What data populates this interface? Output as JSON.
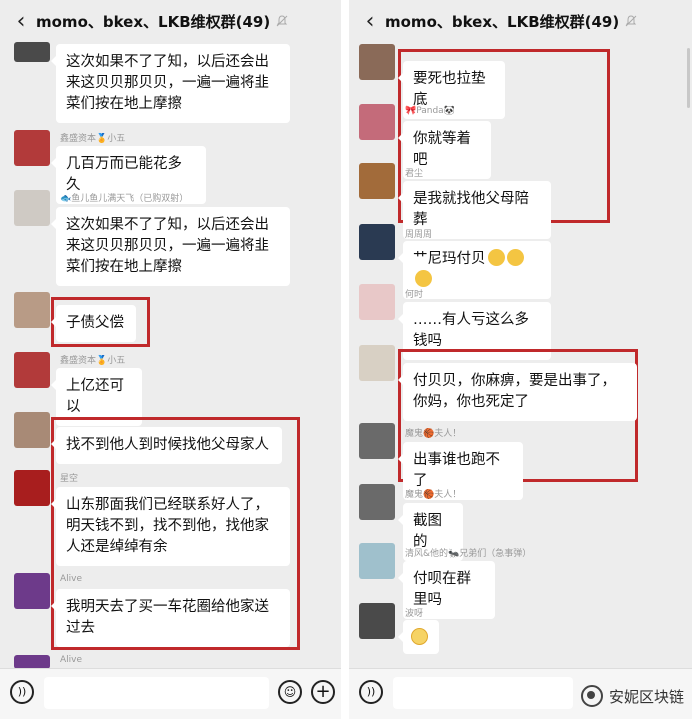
{
  "left": {
    "title": "momo、bkex、LKB维权群(49)",
    "messages": [
      {
        "name": "",
        "text": "这次如果不了了知，以后还会出来这贝贝那贝贝，一遍一遍将韭菜们按在地上摩擦"
      },
      {
        "name": "鑫盛资本🏅小五",
        "text": "几百万而已能花多久"
      },
      {
        "name": "🐟鱼儿鱼儿满天飞（已购双射）",
        "text": "这次如果不了了知，以后还会出来这贝贝那贝贝，一遍一遍将韭菜们按在地上摩擦"
      },
      {
        "name": "",
        "text": "子债父偿"
      },
      {
        "name": "鑫盛资本🏅小五",
        "text": "上亿还可以"
      },
      {
        "name": "",
        "text": "找不到他人到时候找他父母家人"
      },
      {
        "name": "星空",
        "text": "山东那面我们已经联系好人了，明天钱不到，找不到他，找他家人还是绰绰有余"
      },
      {
        "name": "Alive",
        "text": "我明天去了买一车花圈给他家送过去"
      },
      {
        "name": "Alive",
        "text": ""
      }
    ]
  },
  "right": {
    "title": "momo、bkex、LKB维权群(49)",
    "messages": [
      {
        "name": "",
        "text": "要死也拉垫底"
      },
      {
        "name": "🎀Panda🐼",
        "text": "你就等着吧"
      },
      {
        "name": "君尘",
        "text": "是我就找他父母陪葬"
      },
      {
        "name": "周周周",
        "text": "艹尼玛付贝"
      },
      {
        "name": "何时",
        "text": "……有人亏这么多钱吗"
      },
      {
        "name": "",
        "text": "付贝贝，你麻痹，要是出事了，你妈，你也死定了"
      },
      {
        "name": "魔鬼🏀夫人！",
        "text": "出事谁也跑不了"
      },
      {
        "name": "魔鬼🏀夫人！",
        "text": "截图的"
      },
      {
        "name": "清风&他的🐜兄弟们（急事弹）",
        "text": "付呗在群里吗"
      },
      {
        "name": "波呀",
        "text": ""
      }
    ]
  },
  "watermark": "安妮区块链",
  "colors": {
    "accent_red": "#c0292b",
    "chat_bg": "#ededed",
    "bubble": "#ffffff"
  },
  "icons": [
    "back-icon",
    "mute-bell-icon",
    "voice-icon",
    "emoji-icon",
    "plus-icon"
  ]
}
